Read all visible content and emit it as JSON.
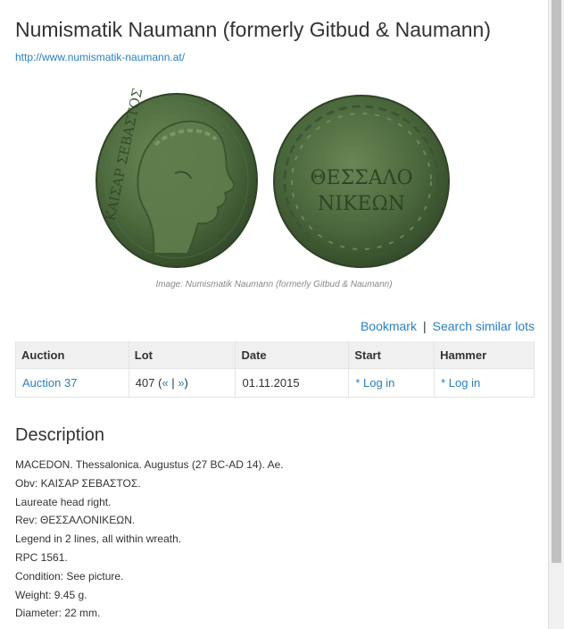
{
  "title": "Numismatik Naumann (formerly Gitbud & Naumann)",
  "website_url": "http://www.numismatik-naumann.at/",
  "image": {
    "caption": "Image: Numismatik Naumann (formerly Gitbud & Naumann)",
    "obverse_legend": "ΚΑΙΣΑΡ ΣΕΒΑΣΤΟΣ",
    "reverse_legend_line1": "ΘΕΣΣΑΛΟ",
    "reverse_legend_line2": "ΝΙΚΕΩΝ"
  },
  "actions": {
    "bookmark": "Bookmark",
    "separator": "|",
    "search_similar": "Search similar lots"
  },
  "table": {
    "headers": [
      "Auction",
      "Lot",
      "Date",
      "Start",
      "Hammer"
    ],
    "row": {
      "auction": "Auction 37",
      "lot_number": "407",
      "lot_open": "(",
      "prev_link": "«",
      "lot_sep": "|",
      "next_link": "»",
      "lot_close": ")",
      "date": "01.11.2015",
      "start": "* Log in",
      "hammer": "* Log in"
    }
  },
  "description": {
    "heading": "Description",
    "lines": [
      "MACEDON. Thessalonica. Augustus (27 BC-AD 14). Ae.",
      "Obv: ΚΑΙΣΑΡ ΣΕΒΑΣΤΟΣ.",
      "Laureate head right.",
      "Rev: ΘΕΣΣΑΛΟΝΙΚΕΩΝ.",
      "Legend in 2 lines, all within wreath.",
      "RPC 1561.",
      "Condition: See picture.",
      "Weight: 9.45 g.",
      "Diameter: 22 mm."
    ]
  },
  "colors": {
    "link": "#2a7fc1",
    "text": "#333333",
    "coin_patina": "#4a6a3c",
    "table_header_bg": "#f0f0f0"
  }
}
